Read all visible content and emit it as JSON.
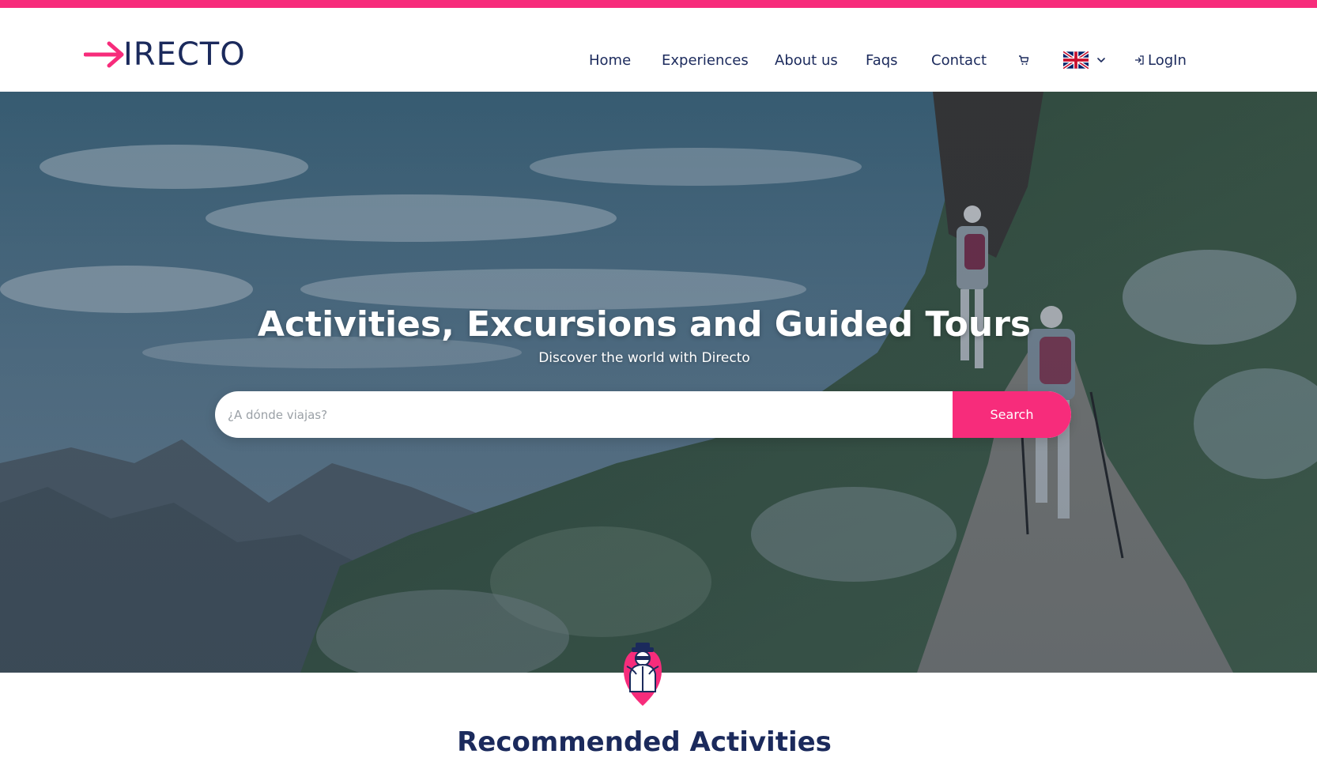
{
  "brand": {
    "name": "IRECTO",
    "accent_color": "#f72c7b",
    "navy_color": "#1b2a5c"
  },
  "nav": {
    "items": [
      {
        "label": "Home"
      },
      {
        "label": "Experiences"
      },
      {
        "label": "About us"
      },
      {
        "label": "Faqs"
      },
      {
        "label": "Contact"
      }
    ],
    "cart_icon": "cart-icon",
    "language_flag": "uk-flag-icon",
    "login_label": "LogIn",
    "login_icon": "login-icon"
  },
  "hero": {
    "title": "Activities, Excursions and Guided Tours",
    "subtitle": "Discover the world with Directo",
    "search": {
      "placeholder": "¿A dónde viajas?",
      "value": "",
      "button_label": "Search"
    }
  },
  "recommended": {
    "title": "Recommended Activities",
    "mascot_icon": "explorer-mascot-icon"
  }
}
